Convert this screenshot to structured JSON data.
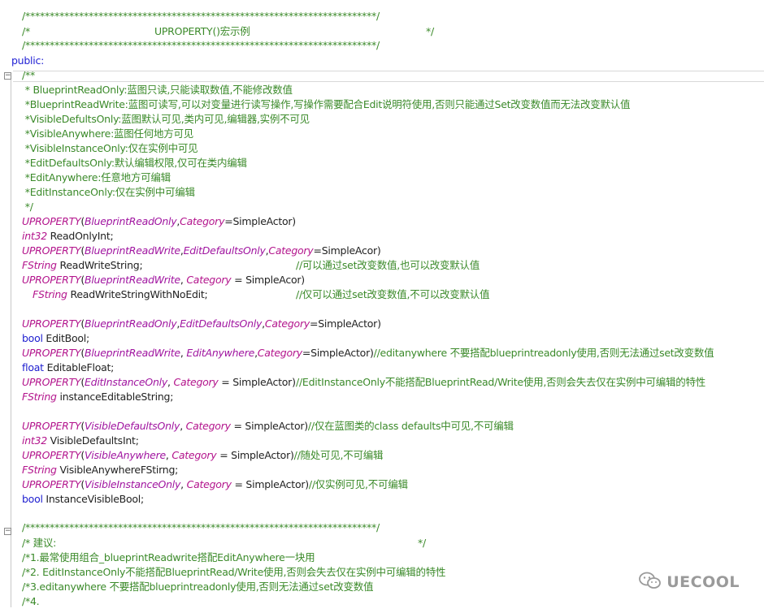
{
  "header": {
    "banner_top": "/************************************************************************/",
    "banner_mid_left": "/*",
    "banner_title": "UPROPERTY()宏示例",
    "banner_mid_right": "*/",
    "banner_bottom": "/************************************************************************/"
  },
  "access": {
    "public": "public:"
  },
  "doc": {
    "open": "/**",
    "lines": [
      " * BlueprintReadOnly:蓝图只读,只能读取数值,不能修改数值",
      " *BlueprintReadWrite:蓝图可读写,可以对变量进行读写操作,写操作需要配合Edit说明符使用,否则只能通过Set改变数值而无法改变默认值",
      " *VisibleDefultsOnly:蓝图默认可见,类内可见,编辑器,实例不可见",
      " *VisibleAnywhere:蓝图任何地方可见",
      " *VisibleInstanceOnly:仅在实例中可见",
      " *EditDefaultsOnly:默认编辑权限,仅可在类内编辑",
      " *EditAnywhere:任意地方可编辑",
      " *EditInstanceOnly:仅在实例中可编辑"
    ],
    "close": " */"
  },
  "code": {
    "macro": "UPROPERTY",
    "category_kw": "Category",
    "t_int32": "int32",
    "t_fstring": "FString",
    "t_bool": "bool",
    "t_float": "float",
    "s_bro": "BlueprintReadOnly",
    "s_brw": "BlueprintReadWrite",
    "s_edo": "EditDefaultsOnly",
    "s_ea": "EditAnywhere",
    "s_eio": "EditInstanceOnly",
    "s_vdo": "VisibleDefaultsOnly",
    "s_va": "VisibleAnywhere",
    "s_vio": "VisibleInstanceOnly",
    "paren_open": "(",
    "comma": ",",
    "comma_sp": ", ",
    "eq_nosp": "=",
    "eq_sp": " = ",
    "val_simpleactor": "SimpleActor",
    "val_simpleacor": "SimpleAcor",
    "close_paren": ")",
    "close_paren_spaced": ")        ",
    "var_readonlyint": " ReadOnlyInt;",
    "var_readwritestring": " ReadWriteString;",
    "var_rwnoedit": " ReadWriteStringWithNoEdit;",
    "var_editbool": " EditBool;",
    "var_editablefloat": " EditableFloat;",
    "var_instanceeditable": " instanceEditableString;",
    "var_visibledefaultsint": " VisibleDefaultsInt;",
    "var_visibleanywhere": " VisibleAnywhereFStirng;",
    "var_instancevisiblebool": " InstanceVisibleBool;",
    "cmt_set_default": "//可以通过set改变数值,也可以改变默认值",
    "cmt_no_default": "//仅可以通过set改变数值,不可以改变默认值",
    "cmt_editanywhere": "//editanywhere 不要搭配blueprintreadonly使用,否则无法通过set改变数值",
    "cmt_editinstance": "//EditInstanceOnly不能搭配BlueprintRead/Write使用,否则会失去仅在实例中可编辑的特性",
    "cmt_visible_defaults": "//仅在蓝图类的class defaults中可见,不可编辑",
    "cmt_visible_anywhere": "//随处可见,不可编辑",
    "cmt_visible_instance": "//仅实例可见,不可编辑"
  },
  "footer": {
    "banner_top": "/************************************************************************/",
    "advice_left": "/* 建议:",
    "advice_right": "*/",
    "items": [
      "/*1.最常使用组合_blueprintReadwrite搭配EditAnywhere一块用",
      "/*2. EditInstanceOnly不能搭配BlueprintRead/Write使用,否则会失去仅在实例中可编辑的特性",
      "/*3.editanywhere 不要搭配blueprintreadonly使用,否则无法通过set改变数值",
      "/*4."
    ]
  },
  "watermark": {
    "text": "UECOOL"
  }
}
